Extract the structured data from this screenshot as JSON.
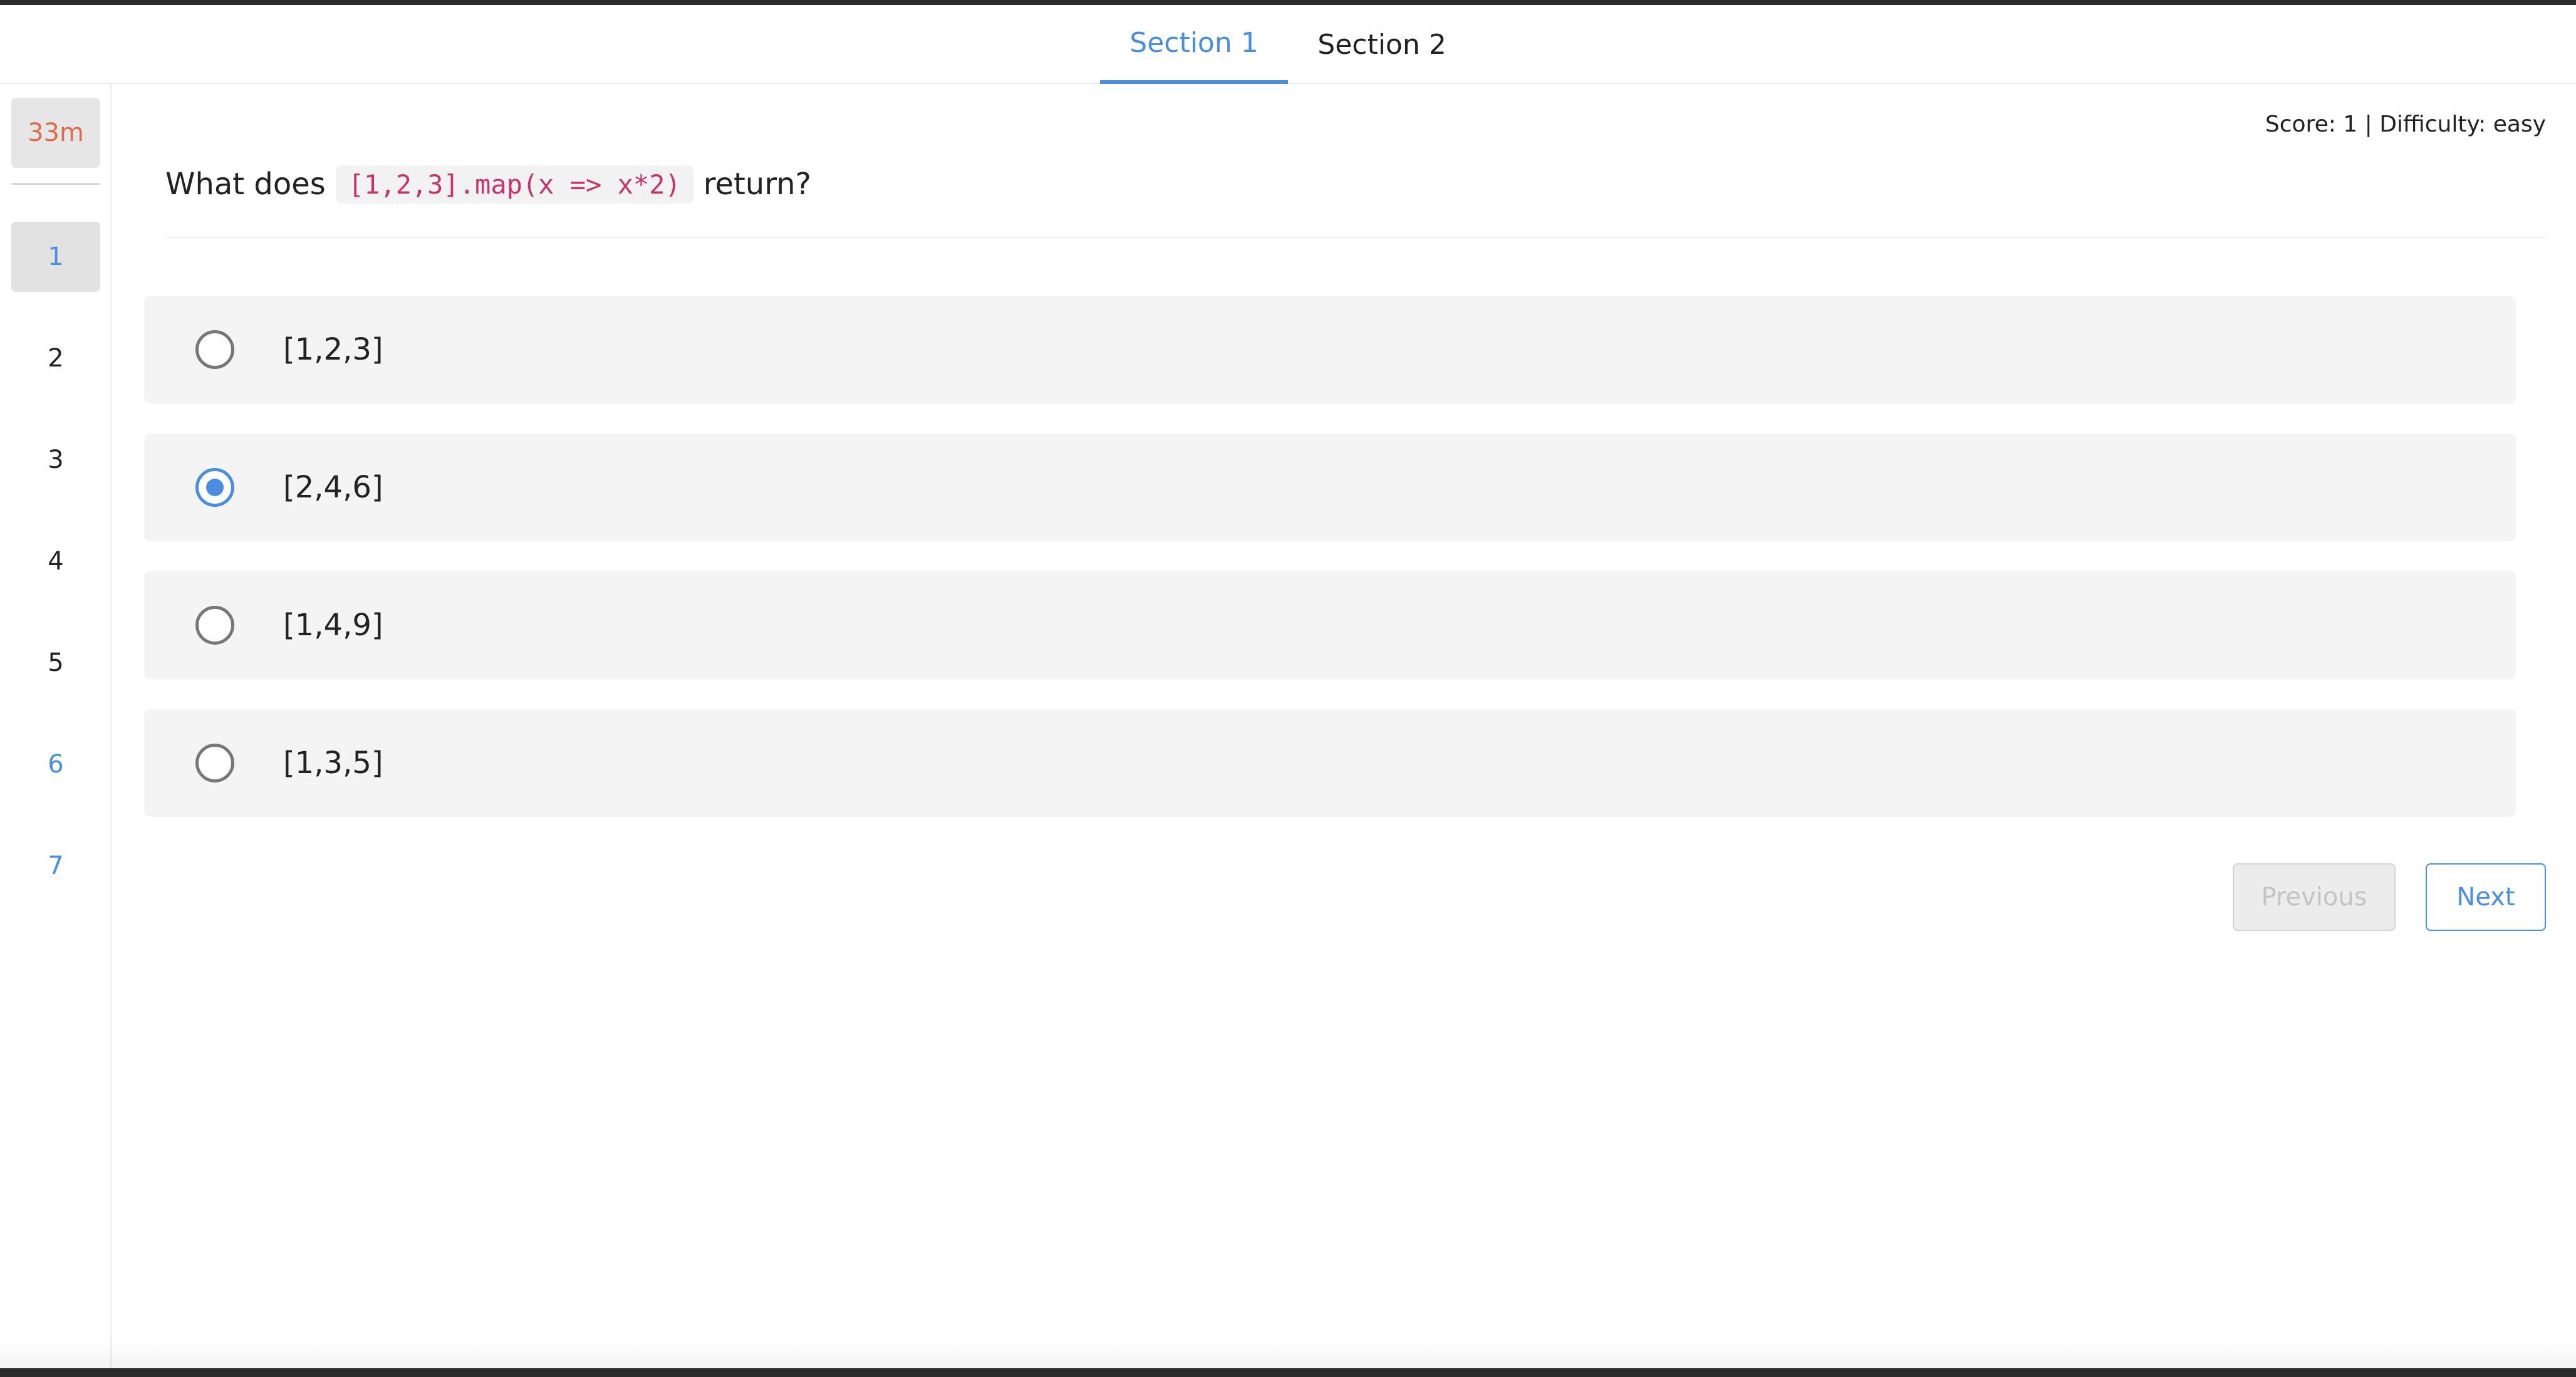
{
  "tabs": [
    {
      "label": "Section 1",
      "active": true
    },
    {
      "label": "Section 2",
      "active": false
    }
  ],
  "sidebar": {
    "timer": "33m",
    "questions": [
      "1",
      "2",
      "3",
      "4",
      "5",
      "6",
      "7"
    ],
    "current": "1"
  },
  "header": {
    "score_text": "Score: 1 | Difficulty: easy"
  },
  "question": {
    "prefix": "What does",
    "code": "[1,2,3].map(x => x*2)",
    "suffix": "return?"
  },
  "options": [
    {
      "label": "[1,2,3]",
      "selected": false
    },
    {
      "label": "[2,4,6]",
      "selected": true
    },
    {
      "label": "[1,4,9]",
      "selected": false
    },
    {
      "label": "[1,3,5]",
      "selected": false
    }
  ],
  "buttons": {
    "previous": "Previous",
    "next": "Next"
  },
  "colors": {
    "accent": "#4a8ee0",
    "timer": "#e06b4a",
    "code": "#c7326f"
  }
}
